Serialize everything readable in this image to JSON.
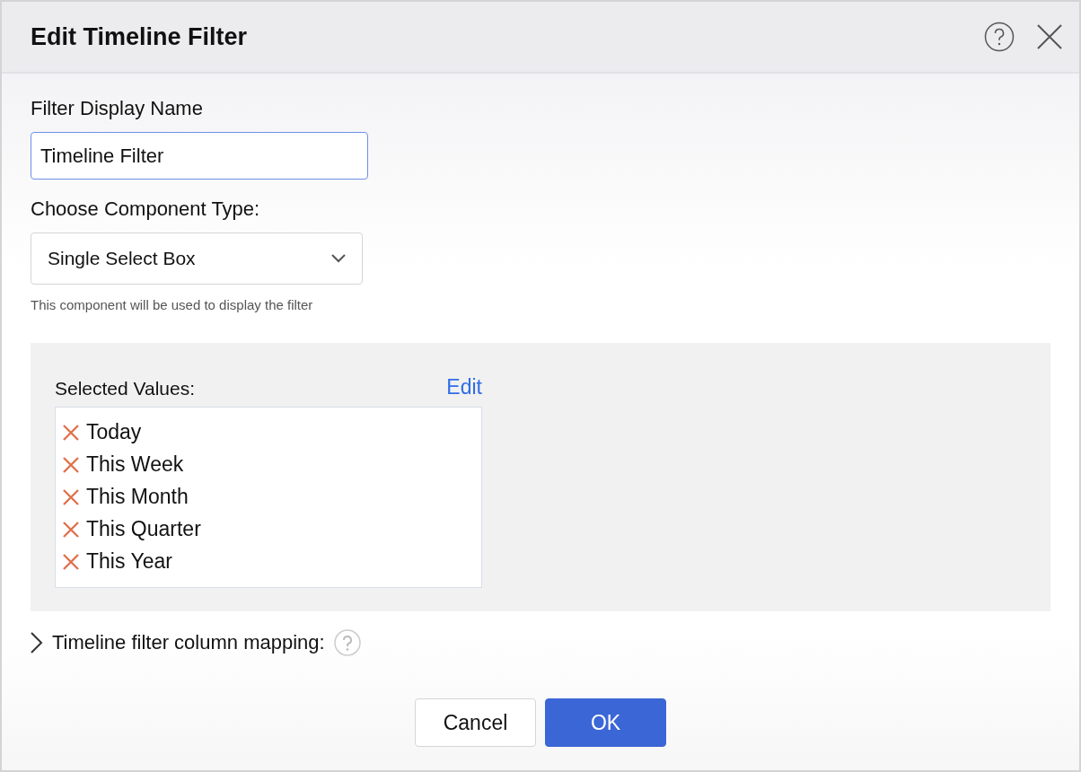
{
  "dialog": {
    "title": "Edit Timeline Filter"
  },
  "display_name": {
    "label": "Filter Display Name",
    "value": "Timeline Filter"
  },
  "component_type": {
    "label": "Choose Component Type:",
    "value": "Single Select Box",
    "hint": "This component will be used to display the filter"
  },
  "selected_values": {
    "label": "Selected Values:",
    "edit_link": "Edit",
    "items": [
      {
        "label": "Today"
      },
      {
        "label": "This Week"
      },
      {
        "label": "This Month"
      },
      {
        "label": "This Quarter"
      },
      {
        "label": "This Year"
      }
    ]
  },
  "column_mapping": {
    "label": "Timeline filter column mapping:",
    "expanded": false
  },
  "buttons": [
    {
      "label": "Cancel",
      "kind": "secondary"
    },
    {
      "label": "OK",
      "kind": "primary"
    }
  ]
}
